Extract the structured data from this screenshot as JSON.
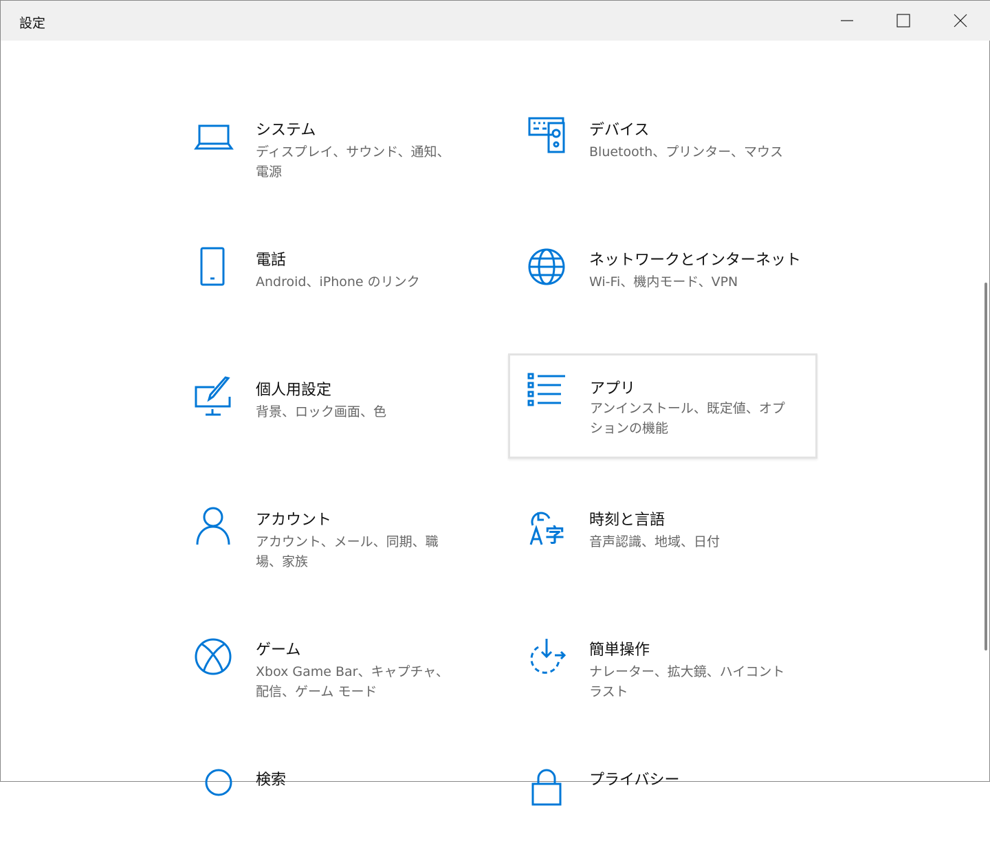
{
  "window": {
    "title": "設定",
    "minimize": "minimize",
    "maximize": "maximize",
    "close": "close"
  },
  "accent": "#0078d7",
  "items": [
    {
      "name": "システム",
      "desc": "ディスプレイ、サウンド、通知、電源",
      "icon": "laptop-icon"
    },
    {
      "name": "デバイス",
      "desc": "Bluetooth、プリンター、マウス",
      "icon": "devices-icon"
    },
    {
      "name": "電話",
      "desc": "Android、iPhone のリンク",
      "icon": "phone-icon"
    },
    {
      "name": "ネットワークとインターネット",
      "desc": "Wi-Fi、機内モード、VPN",
      "icon": "globe-icon"
    },
    {
      "name": "個人用設定",
      "desc": "背景、ロック画面、色",
      "icon": "personalization-icon"
    },
    {
      "name": "アプリ",
      "desc": "アンインストール、既定値、オプションの機能",
      "icon": "apps-list-icon"
    },
    {
      "name": "アカウント",
      "desc": "アカウント、メール、同期、職場、家族",
      "icon": "person-icon"
    },
    {
      "name": "時刻と言語",
      "desc": "音声認識、地域、日付",
      "icon": "time-language-icon"
    },
    {
      "name": "ゲーム",
      "desc": "Xbox Game Bar、キャプチャ、配信、ゲーム モード",
      "icon": "xbox-icon"
    },
    {
      "name": "簡単操作",
      "desc": "ナレーター、拡大鏡、ハイコントラスト",
      "icon": "ease-of-access-icon"
    },
    {
      "name": "検索",
      "desc": "",
      "icon": "search-icon"
    },
    {
      "name": "プライバシー",
      "desc": "",
      "icon": "lock-icon"
    }
  ]
}
